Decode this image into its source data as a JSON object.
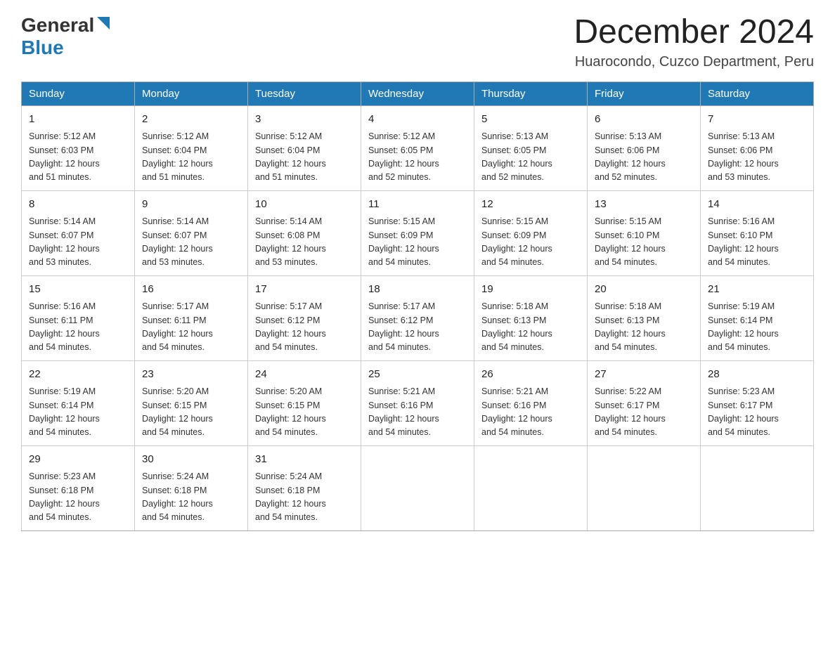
{
  "logo": {
    "general": "General",
    "blue": "Blue",
    "triangle": "▲"
  },
  "title": {
    "month_year": "December 2024",
    "location": "Huarocondo, Cuzco Department, Peru"
  },
  "headers": [
    "Sunday",
    "Monday",
    "Tuesday",
    "Wednesday",
    "Thursday",
    "Friday",
    "Saturday"
  ],
  "weeks": [
    [
      {
        "day": "1",
        "sunrise": "5:12 AM",
        "sunset": "6:03 PM",
        "daylight": "12 hours and 51 minutes."
      },
      {
        "day": "2",
        "sunrise": "5:12 AM",
        "sunset": "6:04 PM",
        "daylight": "12 hours and 51 minutes."
      },
      {
        "day": "3",
        "sunrise": "5:12 AM",
        "sunset": "6:04 PM",
        "daylight": "12 hours and 51 minutes."
      },
      {
        "day": "4",
        "sunrise": "5:12 AM",
        "sunset": "6:05 PM",
        "daylight": "12 hours and 52 minutes."
      },
      {
        "day": "5",
        "sunrise": "5:13 AM",
        "sunset": "6:05 PM",
        "daylight": "12 hours and 52 minutes."
      },
      {
        "day": "6",
        "sunrise": "5:13 AM",
        "sunset": "6:06 PM",
        "daylight": "12 hours and 52 minutes."
      },
      {
        "day": "7",
        "sunrise": "5:13 AM",
        "sunset": "6:06 PM",
        "daylight": "12 hours and 53 minutes."
      }
    ],
    [
      {
        "day": "8",
        "sunrise": "5:14 AM",
        "sunset": "6:07 PM",
        "daylight": "12 hours and 53 minutes."
      },
      {
        "day": "9",
        "sunrise": "5:14 AM",
        "sunset": "6:07 PM",
        "daylight": "12 hours and 53 minutes."
      },
      {
        "day": "10",
        "sunrise": "5:14 AM",
        "sunset": "6:08 PM",
        "daylight": "12 hours and 53 minutes."
      },
      {
        "day": "11",
        "sunrise": "5:15 AM",
        "sunset": "6:09 PM",
        "daylight": "12 hours and 54 minutes."
      },
      {
        "day": "12",
        "sunrise": "5:15 AM",
        "sunset": "6:09 PM",
        "daylight": "12 hours and 54 minutes."
      },
      {
        "day": "13",
        "sunrise": "5:15 AM",
        "sunset": "6:10 PM",
        "daylight": "12 hours and 54 minutes."
      },
      {
        "day": "14",
        "sunrise": "5:16 AM",
        "sunset": "6:10 PM",
        "daylight": "12 hours and 54 minutes."
      }
    ],
    [
      {
        "day": "15",
        "sunrise": "5:16 AM",
        "sunset": "6:11 PM",
        "daylight": "12 hours and 54 minutes."
      },
      {
        "day": "16",
        "sunrise": "5:17 AM",
        "sunset": "6:11 PM",
        "daylight": "12 hours and 54 minutes."
      },
      {
        "day": "17",
        "sunrise": "5:17 AM",
        "sunset": "6:12 PM",
        "daylight": "12 hours and 54 minutes."
      },
      {
        "day": "18",
        "sunrise": "5:17 AM",
        "sunset": "6:12 PM",
        "daylight": "12 hours and 54 minutes."
      },
      {
        "day": "19",
        "sunrise": "5:18 AM",
        "sunset": "6:13 PM",
        "daylight": "12 hours and 54 minutes."
      },
      {
        "day": "20",
        "sunrise": "5:18 AM",
        "sunset": "6:13 PM",
        "daylight": "12 hours and 54 minutes."
      },
      {
        "day": "21",
        "sunrise": "5:19 AM",
        "sunset": "6:14 PM",
        "daylight": "12 hours and 54 minutes."
      }
    ],
    [
      {
        "day": "22",
        "sunrise": "5:19 AM",
        "sunset": "6:14 PM",
        "daylight": "12 hours and 54 minutes."
      },
      {
        "day": "23",
        "sunrise": "5:20 AM",
        "sunset": "6:15 PM",
        "daylight": "12 hours and 54 minutes."
      },
      {
        "day": "24",
        "sunrise": "5:20 AM",
        "sunset": "6:15 PM",
        "daylight": "12 hours and 54 minutes."
      },
      {
        "day": "25",
        "sunrise": "5:21 AM",
        "sunset": "6:16 PM",
        "daylight": "12 hours and 54 minutes."
      },
      {
        "day": "26",
        "sunrise": "5:21 AM",
        "sunset": "6:16 PM",
        "daylight": "12 hours and 54 minutes."
      },
      {
        "day": "27",
        "sunrise": "5:22 AM",
        "sunset": "6:17 PM",
        "daylight": "12 hours and 54 minutes."
      },
      {
        "day": "28",
        "sunrise": "5:23 AM",
        "sunset": "6:17 PM",
        "daylight": "12 hours and 54 minutes."
      }
    ],
    [
      {
        "day": "29",
        "sunrise": "5:23 AM",
        "sunset": "6:18 PM",
        "daylight": "12 hours and 54 minutes."
      },
      {
        "day": "30",
        "sunrise": "5:24 AM",
        "sunset": "6:18 PM",
        "daylight": "12 hours and 54 minutes."
      },
      {
        "day": "31",
        "sunrise": "5:24 AM",
        "sunset": "6:18 PM",
        "daylight": "12 hours and 54 minutes."
      },
      null,
      null,
      null,
      null
    ]
  ],
  "labels": {
    "sunrise_prefix": "Sunrise: ",
    "sunset_prefix": "Sunset: ",
    "daylight_prefix": "Daylight: "
  }
}
